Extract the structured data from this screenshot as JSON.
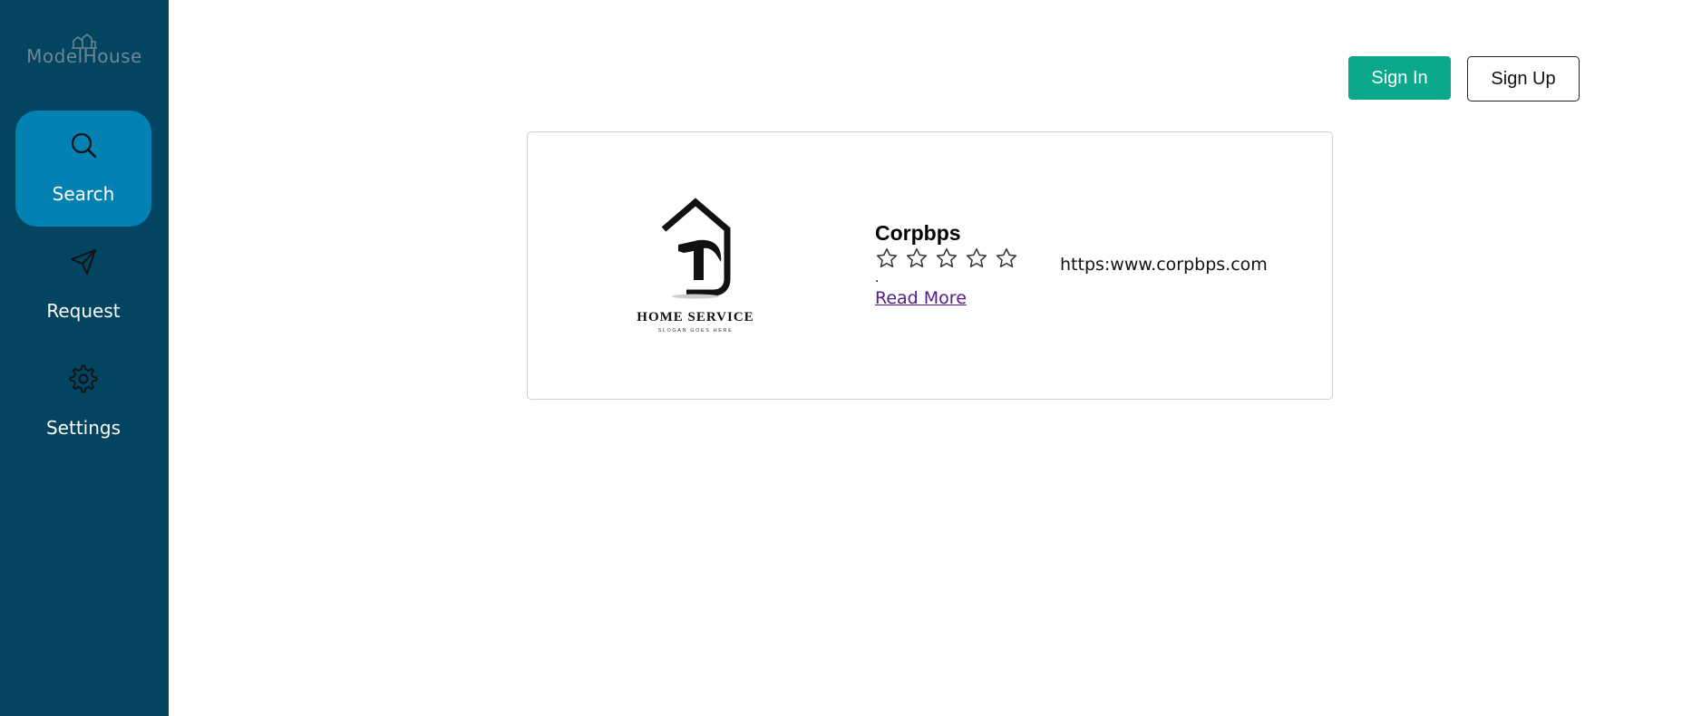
{
  "brand": {
    "logo_text": "ModelHouse",
    "logo_icon": "house-skyline-icon"
  },
  "sidebar": {
    "items": [
      {
        "label": "Search",
        "icon": "search-icon",
        "active": true
      },
      {
        "label": "Request",
        "icon": "send-icon",
        "active": false
      },
      {
        "label": "Settings",
        "icon": "gear-icon",
        "active": false
      }
    ]
  },
  "header": {
    "signin_label": "Sign In",
    "signup_label": "Sign Up"
  },
  "listing": {
    "logo_title": "HOME SERVICE",
    "logo_slogan": "SLOGAN GOES HERE",
    "name": "Corpbps",
    "rating": 0,
    "rating_max": 5,
    "description": ".",
    "read_more_label": "Read More",
    "url": "https:www.corpbps.com"
  },
  "colors": {
    "sidebar_bg": "#034460",
    "active_nav": "#0381b3",
    "signin_bg": "#0ba88b",
    "link": "#551a8b"
  }
}
